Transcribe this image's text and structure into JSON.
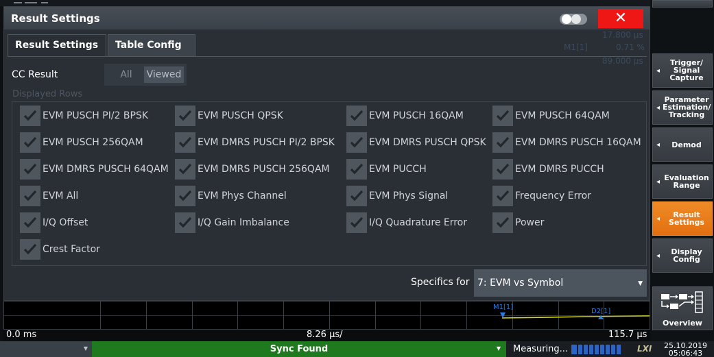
{
  "dialog": {
    "title": "Result Settings",
    "close_glyph": "✕",
    "tabs": [
      {
        "label": "Result Settings",
        "active": false
      },
      {
        "label": "Table Config",
        "active": true
      }
    ],
    "cc_result": {
      "label": "CC Result",
      "options": [
        "All",
        "Viewed"
      ],
      "selected": "Viewed"
    },
    "displayed_rows_label": "Displayed Rows",
    "checkboxes": [
      {
        "label": "EVM PUSCH PI/2 BPSK",
        "checked": true
      },
      {
        "label": "EVM PUSCH QPSK",
        "checked": true
      },
      {
        "label": "EVM PUSCH 16QAM",
        "checked": true
      },
      {
        "label": "EVM PUSCH 64QAM",
        "checked": true
      },
      {
        "label": "EVM PUSCH 256QAM",
        "checked": true
      },
      {
        "label": "EVM DMRS PUSCH PI/2 BPSK",
        "checked": true
      },
      {
        "label": "EVM DMRS PUSCH QPSK",
        "checked": true
      },
      {
        "label": "EVM DMRS PUSCH 16QAM",
        "checked": true
      },
      {
        "label": "EVM DMRS PUSCH 64QAM",
        "checked": true
      },
      {
        "label": "EVM DMRS PUSCH 256QAM",
        "checked": true
      },
      {
        "label": "EVM PUCCH",
        "checked": true
      },
      {
        "label": "EVM DMRS PUCCH",
        "checked": true
      },
      {
        "label": "EVM All",
        "checked": true
      },
      {
        "label": "EVM Phys Channel",
        "checked": true
      },
      {
        "label": "EVM Phys Signal",
        "checked": true
      },
      {
        "label": "Frequency Error",
        "checked": true
      },
      {
        "label": "I/Q Offset",
        "checked": true
      },
      {
        "label": "I/Q Gain Imbalance",
        "checked": true
      },
      {
        "label": "I/Q Quadrature Error",
        "checked": true
      },
      {
        "label": "Power",
        "checked": true
      },
      {
        "label": "Crest Factor",
        "checked": true
      }
    ],
    "specifics": {
      "label": "Specifics for",
      "value": "7: EVM vs Symbol"
    }
  },
  "background_readouts": {
    "v1": "17.800 µs",
    "m1_label": "M1[1]",
    "m1_value": "0.71 %",
    "v2": "89.000 µs"
  },
  "graph": {
    "marker1": "M1[1]",
    "marker2": "D2[1]",
    "axis_start": "0.0 ms",
    "axis_step": "8.26 µs/",
    "axis_end": "115.7 µs",
    "trace_color": "#d8d810",
    "marker_color": "#2c7be3"
  },
  "status": {
    "sync": "Sync Found",
    "measuring": "Measuring...",
    "lxi": "LXI",
    "date": "25.10.2019",
    "time": "05:06:43",
    "sync_color": "#1f7a1f"
  },
  "softkeys": [
    {
      "label": "Trigger/ Signal Capture",
      "active": false
    },
    {
      "label": "Parameter Estimation/ Tracking",
      "active": false
    },
    {
      "label": "Demod",
      "active": false
    },
    {
      "label": "Evaluation Range",
      "active": false
    },
    {
      "label": "Result Settings",
      "active": true
    },
    {
      "label": "Display Config",
      "active": false
    },
    {
      "label": "Overview",
      "active": false
    }
  ]
}
